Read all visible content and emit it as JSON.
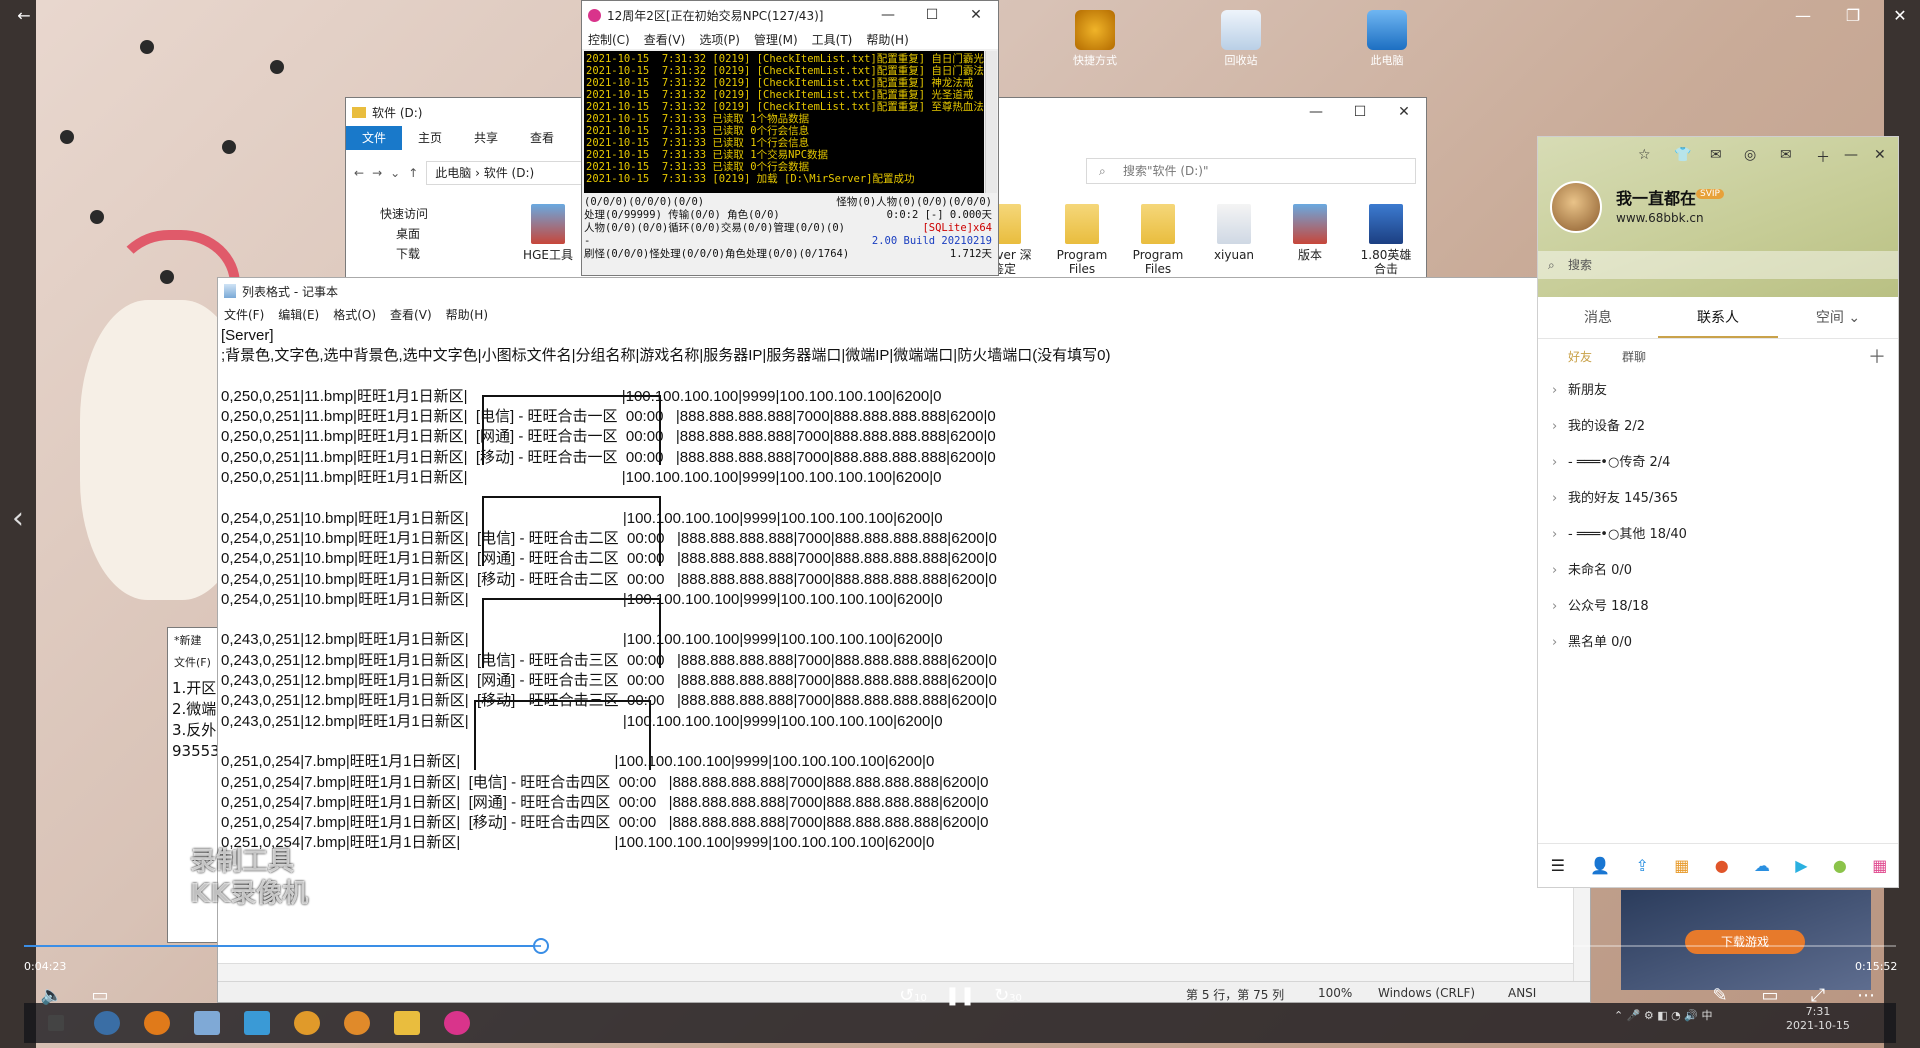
{
  "npc_window": {
    "title": "12周年2区[正在初始交易NPC(127/43)]",
    "menu": [
      "控制(C)",
      "查看(V)",
      "选项(P)",
      "管理(M)",
      "工具(T)",
      "帮助(H)"
    ],
    "log": [
      "2021-10-15  7:31:32 [0219] [CheckItemList.txt]配置重复] 自日门霸光",
      "2021-10-15  7:31:32 [0219] [CheckItemList.txt]配置重复] 自日门霸法师",
      "2021-10-15  7:31:32 [0219] [CheckItemList.txt]配置重复] 神龙法戒",
      "2021-10-15  7:31:32 [0219] [CheckItemList.txt]配置重复] 光圣道戒",
      "2021-10-15  7:31:32 [0219] [CheckItemList.txt]配置重复] 至尊热血法剑",
      "2021-10-15  7:31:33 已读取 1个物品数据",
      "2021-10-15  7:31:33 已读取 0个行会信息",
      "2021-10-15  7:31:33 已读取 1个行会信息",
      "2021-10-15  7:31:33 已读取 1个交易NPC数据",
      "2021-10-15  7:31:33 已读取 0个行会数据",
      "2021-10-15  7:31:33 [0219] 加载 [D:\\MirServer]配置成功"
    ],
    "status_rows": [
      {
        "left": "(0/0/0)(0/0/0)(0/0)",
        "right": "怪物(0)人物(0)(0/0)(0/0/0)"
      },
      {
        "left": "处理(0/99999) 传输(0/0) 角色(0/0)",
        "right": "0:0:2 [-]    0.000天"
      },
      {
        "left": "人物(0/0)(0/0)循环(0/0)交易(0/0)管理(0/0)(0)",
        "right": "[SQLite]x64"
      },
      {
        "left": "-",
        "right": "2.00 Build 20210219"
      },
      {
        "left": "刷怪(0/0/0)怪处理(0/0/0)角色处理(0/0)(0/1764)",
        "right": "1.712天"
      }
    ]
  },
  "explorer": {
    "title": "软件 (D:)",
    "tabs": [
      "文件",
      "主页",
      "共享",
      "查看"
    ],
    "path_root": "此电脑",
    "path_folder": "软件 (D:)",
    "search_placeholder": "搜索\"软件 (D:)\"",
    "nav": [
      "快速访问",
      "桌面",
      "下载"
    ],
    "items": [
      {
        "label": "HGE工具"
      },
      {
        "label": "Server 深鉴定"
      },
      {
        "label": "Program Files"
      },
      {
        "label": "Program Files (x86)"
      },
      {
        "label": "xiyuan"
      },
      {
        "label": "版本"
      },
      {
        "label": "1.80英雄合击"
      }
    ]
  },
  "desktop_icons": [
    {
      "label": "快捷方式"
    },
    {
      "label": "回收站"
    },
    {
      "label": "此电脑"
    }
  ],
  "notepad": {
    "title": "列表格式 - 记事本",
    "menu": [
      "文件(F)",
      "编辑(E)",
      "格式(O)",
      "查看(V)",
      "帮助(H)"
    ],
    "lines": [
      "[Server]",
      ";背景色,文字色,选中背景色,选中文字色|小图标文件名|分组名称|游戏名称|服务器IP|服务器端口|微端IP|微端端口|防火墙端口(没有填写0)",
      "",
      "0,250,0,251|11.bmp|旺旺1月1日新区|                                     |100.100.100.100|9999|100.100.100.100|6200|0",
      "0,250,0,251|11.bmp|旺旺1月1日新区|  [电信] - 旺旺合击一区  00:00   |888.888.888.888|7000|888.888.888.888|6200|0",
      "0,250,0,251|11.bmp|旺旺1月1日新区|  [网通] - 旺旺合击一区  00:00   |888.888.888.888|7000|888.888.888.888|6200|0",
      "0,250,0,251|11.bmp|旺旺1月1日新区|  [移动] - 旺旺合击一区  00:00   |888.888.888.888|7000|888.888.888.888|6200|0",
      "0,250,0,251|11.bmp|旺旺1月1日新区|                                     |100.100.100.100|9999|100.100.100.100|6200|0",
      "",
      "0,254,0,251|10.bmp|旺旺1月1日新区|                                     |100.100.100.100|9999|100.100.100.100|6200|0",
      "0,254,0,251|10.bmp|旺旺1月1日新区|  [电信] - 旺旺合击二区  00:00   |888.888.888.888|7000|888.888.888.888|6200|0",
      "0,254,0,251|10.bmp|旺旺1月1日新区|  [网通] - 旺旺合击二区  00:00   |888.888.888.888|7000|888.888.888.888|6200|0",
      "0,254,0,251|10.bmp|旺旺1月1日新区|  [移动] - 旺旺合击二区  00:00   |888.888.888.888|7000|888.888.888.888|6200|0",
      "0,254,0,251|10.bmp|旺旺1月1日新区|                                     |100.100.100.100|9999|100.100.100.100|6200|0",
      "",
      "0,243,0,251|12.bmp|旺旺1月1日新区|                                     |100.100.100.100|9999|100.100.100.100|6200|0",
      "0,243,0,251|12.bmp|旺旺1月1日新区|  [电信] - 旺旺合击三区  00:00   |888.888.888.888|7000|888.888.888.888|6200|0",
      "0,243,0,251|12.bmp|旺旺1月1日新区|  [网通] - 旺旺合击三区  00:00   |888.888.888.888|7000|888.888.888.888|6200|0",
      "0,243,0,251|12.bmp|旺旺1月1日新区|  [移动] - 旺旺合击三区  00:00   |888.888.888.888|7000|888.888.888.888|6200|0",
      "0,243,0,251|12.bmp|旺旺1月1日新区|                                     |100.100.100.100|9999|100.100.100.100|6200|0",
      "",
      "0,251,0,254|7.bmp|旺旺1月1日新区|                                     |100.100.100.100|9999|100.100.100.100|6200|0",
      "0,251,0,254|7.bmp|旺旺1月1日新区|  [电信] - 旺旺合击四区  00:00   |888.888.888.888|7000|888.888.888.888|6200|0",
      "0,251,0,254|7.bmp|旺旺1月1日新区|  [网通] - 旺旺合击四区  00:00   |888.888.888.888|7000|888.888.888.888|6200|0",
      "0,251,0,254|7.bmp|旺旺1月1日新区|  [移动] - 旺旺合击四区  00:00   |888.888.888.888|7000|888.888.888.888|6200|0",
      "0,251,0,254|7.bmp|旺旺1月1日新区|                                     |100.100.100.100|9999|100.100.100.100|6200|0"
    ],
    "status": {
      "position": "第 5 行，第 75 列",
      "zoom": "100%",
      "eol": "Windows (CRLF)",
      "encoding": "ANSI"
    }
  },
  "notepad2": {
    "title": "*新建",
    "menu": "文件(F)",
    "lines": [
      "1.开区",
      "2.微端",
      "3.反外",
      "93553"
    ]
  },
  "qq": {
    "nickname": "我一直都在",
    "vip": "SVIP",
    "signature": "www.68bbk.cn",
    "search_placeholder": "搜索",
    "tabs": [
      "消息",
      "联系人",
      "空间 ⌄"
    ],
    "sub_tabs": [
      "好友",
      "群聊"
    ],
    "groups": [
      "新朋友",
      "我的设备 2/2",
      "- ═══•○传奇 2/4",
      "我的好友 145/365",
      "- ═══•○其他 18/40",
      "未命名 0/0",
      "公众号 18/18",
      "黑名单 0/0"
    ]
  },
  "player": {
    "current_time": "0:04:23",
    "total_time": "0:15:52",
    "progress": 0.276,
    "watermark_line1": "录制工具",
    "watermark_line2": "KK录像机",
    "rewind_label": "10",
    "forward_label": "30",
    "ad_button": "下载游戏"
  },
  "taskbar": {
    "clock_time": "7:31",
    "clock_date": "2021-10-15",
    "ime": "中"
  },
  "colors": {
    "accent": "#1979ca",
    "console_text": "#e6c800",
    "progress": "#3a8ee6"
  }
}
